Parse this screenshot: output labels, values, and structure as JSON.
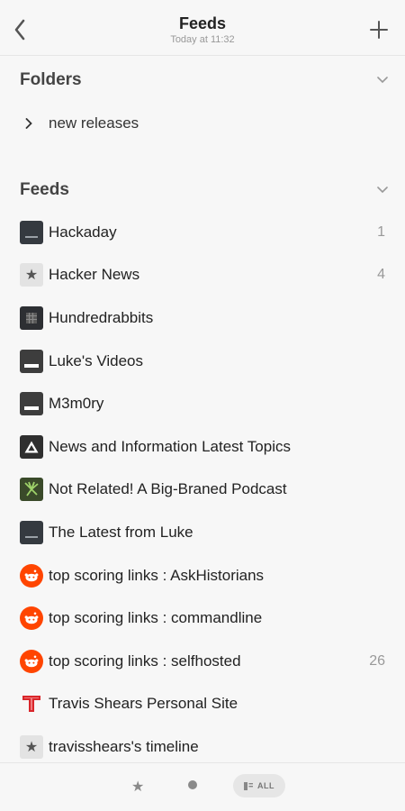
{
  "header": {
    "title": "Feeds",
    "subtitle": "Today at 11:32"
  },
  "folders": {
    "title": "Folders",
    "items": [
      {
        "label": "new releases"
      }
    ]
  },
  "feeds": {
    "title": "Feeds",
    "items": [
      {
        "label": "Hackaday",
        "count": "1",
        "icon": "dark-square-icon"
      },
      {
        "label": "Hacker News",
        "count": "4",
        "icon": "star-icon"
      },
      {
        "label": "Hundredrabbits",
        "count": "",
        "icon": "grid-icon"
      },
      {
        "label": "Luke's Videos",
        "count": "",
        "icon": "video-icon"
      },
      {
        "label": "M3m0ry",
        "count": "",
        "icon": "video-icon"
      },
      {
        "label": "News and Information Latest Topics",
        "count": "",
        "icon": "triangle-logo-icon"
      },
      {
        "label": "Not Related! A Big-Braned Podcast",
        "count": "",
        "icon": "podcast-icon"
      },
      {
        "label": "The Latest from Luke",
        "count": "",
        "icon": "dark-square-icon"
      },
      {
        "label": "top scoring links : AskHistorians",
        "count": "",
        "icon": "reddit-icon"
      },
      {
        "label": "top scoring links : commandline",
        "count": "",
        "icon": "reddit-icon"
      },
      {
        "label": "top scoring links : selfhosted",
        "count": "26",
        "icon": "reddit-icon"
      },
      {
        "label": "Travis Shears Personal Site",
        "count": "",
        "icon": "t-logo-icon"
      },
      {
        "label": "travisshears's timeline",
        "count": "",
        "icon": "star-icon"
      }
    ]
  },
  "bottom_bar": {
    "all_label": "ALL"
  },
  "colors": {
    "background": "#f7f7f7",
    "reddit": "#ff4500",
    "travis_red": "#d9262b"
  }
}
